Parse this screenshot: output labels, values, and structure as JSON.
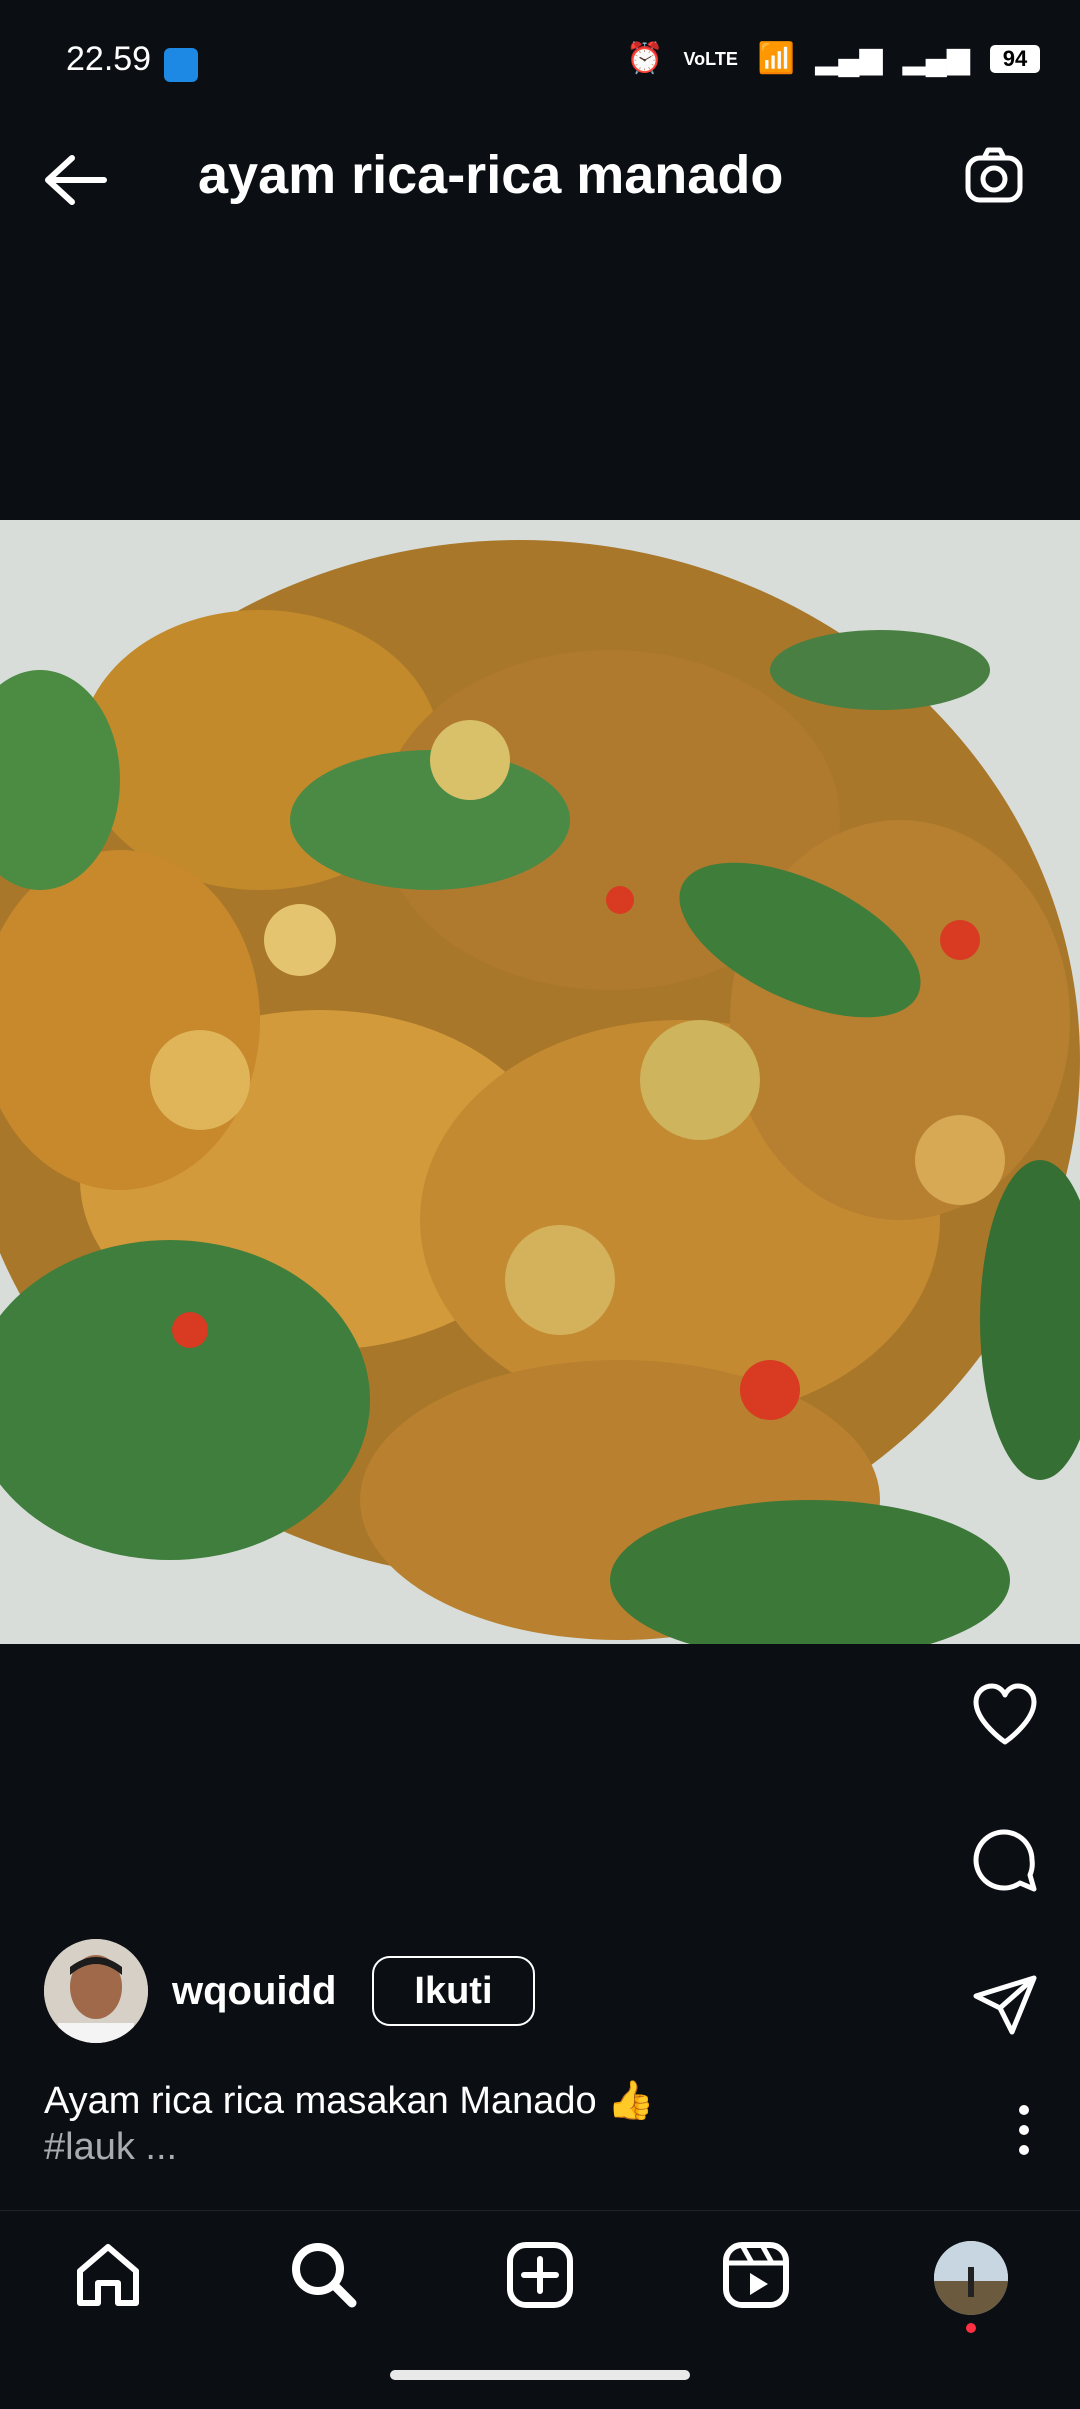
{
  "status_bar": {
    "time": "22.59",
    "battery": "94"
  },
  "header": {
    "title": "ayam rica-rica manado"
  },
  "post": {
    "author": "wqouidd",
    "follow_label": "Ikuti",
    "caption_line1": "Ayam rica rica masakan Manado 👍",
    "caption_line2": "#lauk ..."
  },
  "icons": {
    "back": "arrow-left-icon",
    "camera": "camera-icon",
    "like": "heart-icon",
    "comment": "comment-icon",
    "share": "send-icon",
    "more": "more-vertical-icon",
    "home": "home-icon",
    "search": "search-icon",
    "create": "plus-square-icon",
    "reels": "reels-icon",
    "profile": "profile-avatar"
  },
  "colors": {
    "background": "#0b0f14",
    "text": "#ffffff",
    "muted": "#a8abb0",
    "notification_dot": "#ff3040"
  }
}
